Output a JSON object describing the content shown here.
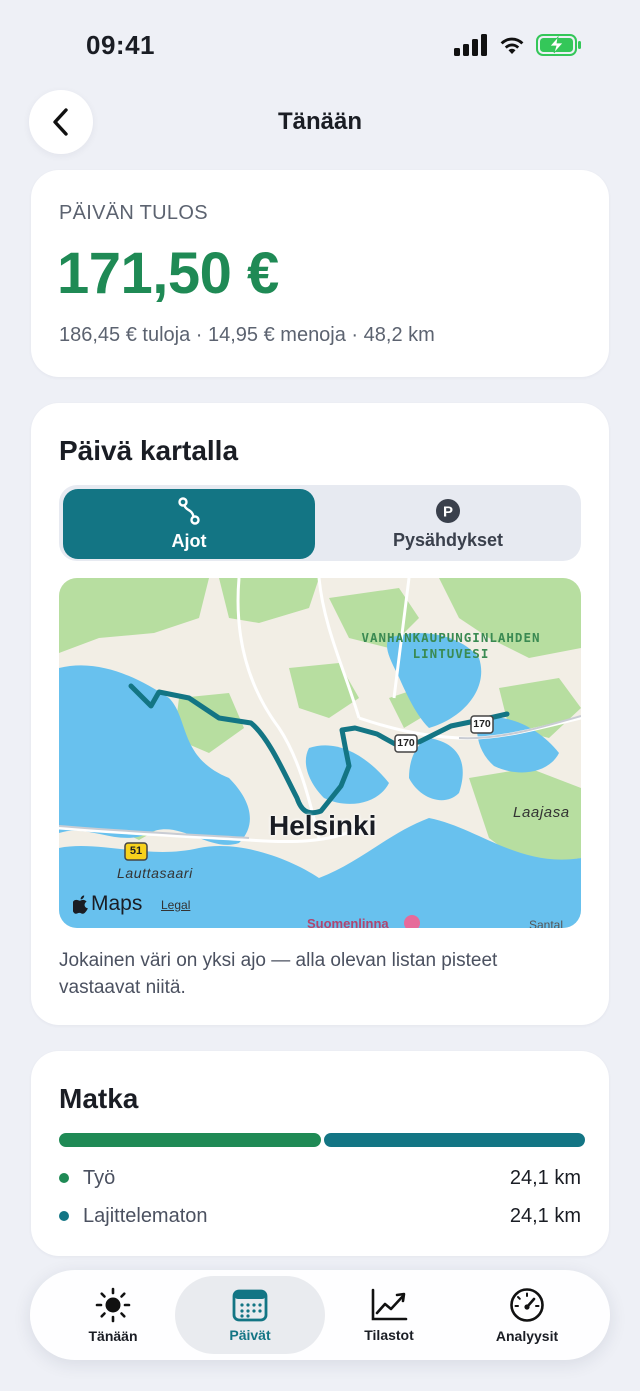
{
  "status_bar": {
    "time": "09:41"
  },
  "header": {
    "title": "Tänään",
    "back_icon": "chevron-left-icon"
  },
  "result": {
    "label": "PÄIVÄN TULOS",
    "value": "171,50 €",
    "summary": "186,45 € tuloja · 14,95 € menoja · 48,2 km",
    "value_color": "#1f8a55"
  },
  "map_section": {
    "title": "Päivä kartalla",
    "tabs": [
      {
        "label": "Ajot",
        "icon": "route-icon",
        "selected": true
      },
      {
        "label": "Pysähdykset",
        "icon": "parking-icon",
        "selected": false
      }
    ],
    "map": {
      "labels": {
        "city": "Helsinki",
        "district": "Lauttasaari",
        "east": "Laajasa",
        "reserve_line1": "VANHANKAUPUNGINLAHDEN",
        "reserve_line2": "LINTUVESI",
        "island": "Suomenlinna",
        "maps_brand": "Maps",
        "legal": "Legal",
        "corner": "Santal"
      },
      "road_shields": [
        "170",
        "170",
        "51"
      ],
      "route_color": "#137584"
    },
    "note": "Jokainen väri on yksi ajo — alla olevan listan pisteet vastaavat niitä."
  },
  "distance": {
    "title": "Matka",
    "items": [
      {
        "label": "Työ",
        "value": "24,1 km",
        "fraction": 0.5,
        "color": "#1f8a55"
      },
      {
        "label": "Lajittelematon",
        "value": "24,1 km",
        "fraction": 0.5,
        "color": "#137584"
      }
    ]
  },
  "tab_bar": {
    "items": [
      {
        "label": "Tänään",
        "icon": "sun-icon",
        "active": false
      },
      {
        "label": "Päivät",
        "icon": "calendar-icon",
        "active": true
      },
      {
        "label": "Tilastot",
        "icon": "chart-icon",
        "active": false
      },
      {
        "label": "Analyysit",
        "icon": "gauge-icon",
        "active": false
      }
    ]
  },
  "colors": {
    "accent": "#137584",
    "positive": "#1f8a55",
    "background": "#eef0f6"
  }
}
